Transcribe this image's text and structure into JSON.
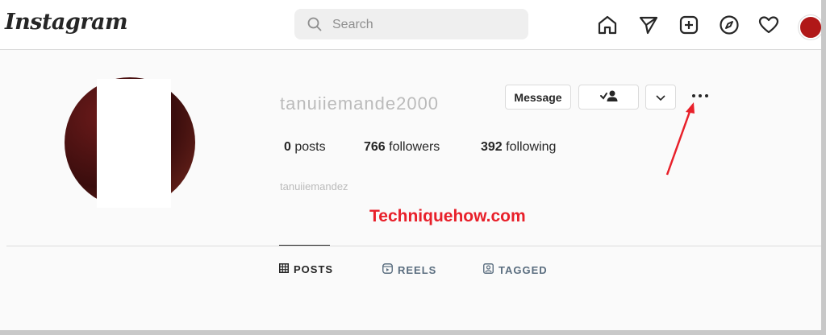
{
  "header": {
    "logo_text": "Instagram",
    "search": {
      "placeholder": "Search"
    },
    "nav_icons": [
      "home-icon",
      "direct-message-icon",
      "new-post-icon",
      "explore-icon",
      "activity-heart-icon",
      "profile-avatar"
    ]
  },
  "profile": {
    "username": "tanuiiemande2000",
    "buttons": {
      "message": "Message",
      "following_icon": "person-check-icon",
      "more_suggest_icon": "chevron-down-icon",
      "options_icon": "more-options-icon"
    },
    "stats": {
      "posts_count": "0",
      "posts_label": "posts",
      "followers_count": "766",
      "followers_label": "followers",
      "following_count": "392",
      "following_label": "following"
    },
    "full_name": "tanuiiemandez"
  },
  "watermark": "Techniquehow.com",
  "tabs": [
    {
      "label": "POSTS",
      "icon": "grid-icon",
      "active": true
    },
    {
      "label": "REELS",
      "icon": "reels-icon",
      "active": false
    },
    {
      "label": "TAGGED",
      "icon": "tagged-icon",
      "active": false
    }
  ],
  "colors": {
    "annotation_red": "#e8202a",
    "text_primary": "#262626",
    "border": "#dbdbdb"
  }
}
